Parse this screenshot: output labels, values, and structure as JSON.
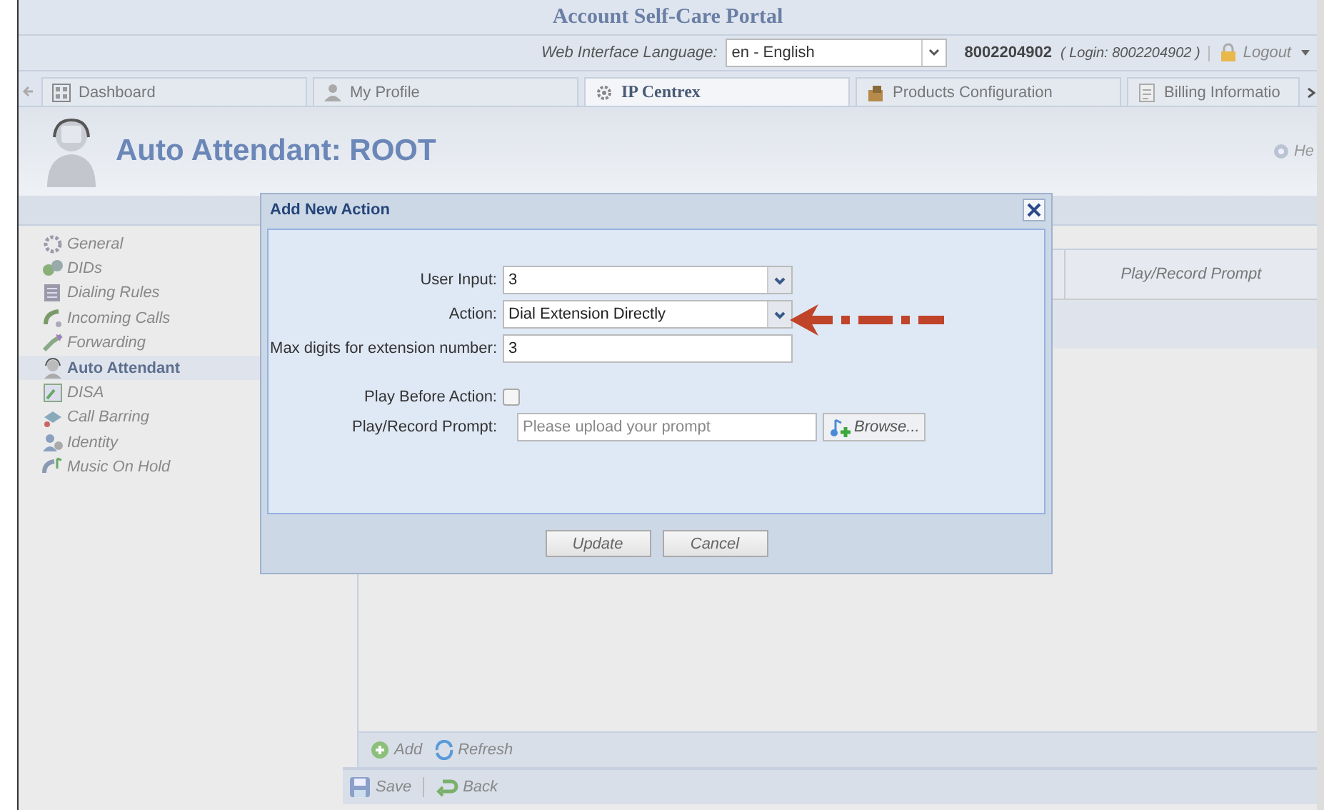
{
  "portal": {
    "title": "Account Self-Care Portal",
    "language_label": "Web Interface Language:",
    "language": "en - English",
    "account": "8002204902",
    "login": "( Login: 8002204902 )",
    "logout": "Logout"
  },
  "tabs": [
    {
      "label": "Dashboard",
      "selected": false
    },
    {
      "label": "My Profile",
      "selected": false
    },
    {
      "label": "IP Centrex",
      "selected": true
    },
    {
      "label": "Products Configuration",
      "selected": false
    },
    {
      "label": "Billing Informatio",
      "selected": false
    }
  ],
  "page": {
    "title": "Auto Attendant: ROOT",
    "help": "He"
  },
  "sidebar": {
    "items": [
      {
        "label": "General",
        "selected": false
      },
      {
        "label": "DIDs",
        "selected": false
      },
      {
        "label": "Dialing Rules",
        "selected": false
      },
      {
        "label": "Incoming Calls",
        "selected": false
      },
      {
        "label": "Forwarding",
        "selected": false
      },
      {
        "label": "Auto Attendant",
        "selected": true
      },
      {
        "label": "DISA",
        "selected": false
      },
      {
        "label": "Call Barring",
        "selected": false
      },
      {
        "label": "Identity",
        "selected": false
      },
      {
        "label": "Music On Hold",
        "selected": false
      }
    ]
  },
  "grid": {
    "column": "Play/Record Prompt",
    "toolbar": [
      "Add",
      "Refresh"
    ]
  },
  "footer": [
    "Save",
    "Back"
  ],
  "dialog": {
    "title": "Add New Action",
    "fields": [
      {
        "kind": "select",
        "label": "User Input:",
        "value": "3"
      },
      {
        "kind": "select",
        "label": "Action:",
        "value": "Dial Extension Directly"
      },
      {
        "kind": "text",
        "label": "Max digits for extension number:",
        "value": "3"
      },
      {
        "kind": "checkbox",
        "label": "Play Before Action:",
        "checked": false
      },
      {
        "kind": "file",
        "label": "Play/Record Prompt:",
        "placeholder": "Please upload your prompt",
        "button": "Browse..."
      }
    ],
    "buttons": [
      "Update",
      "Cancel"
    ]
  }
}
